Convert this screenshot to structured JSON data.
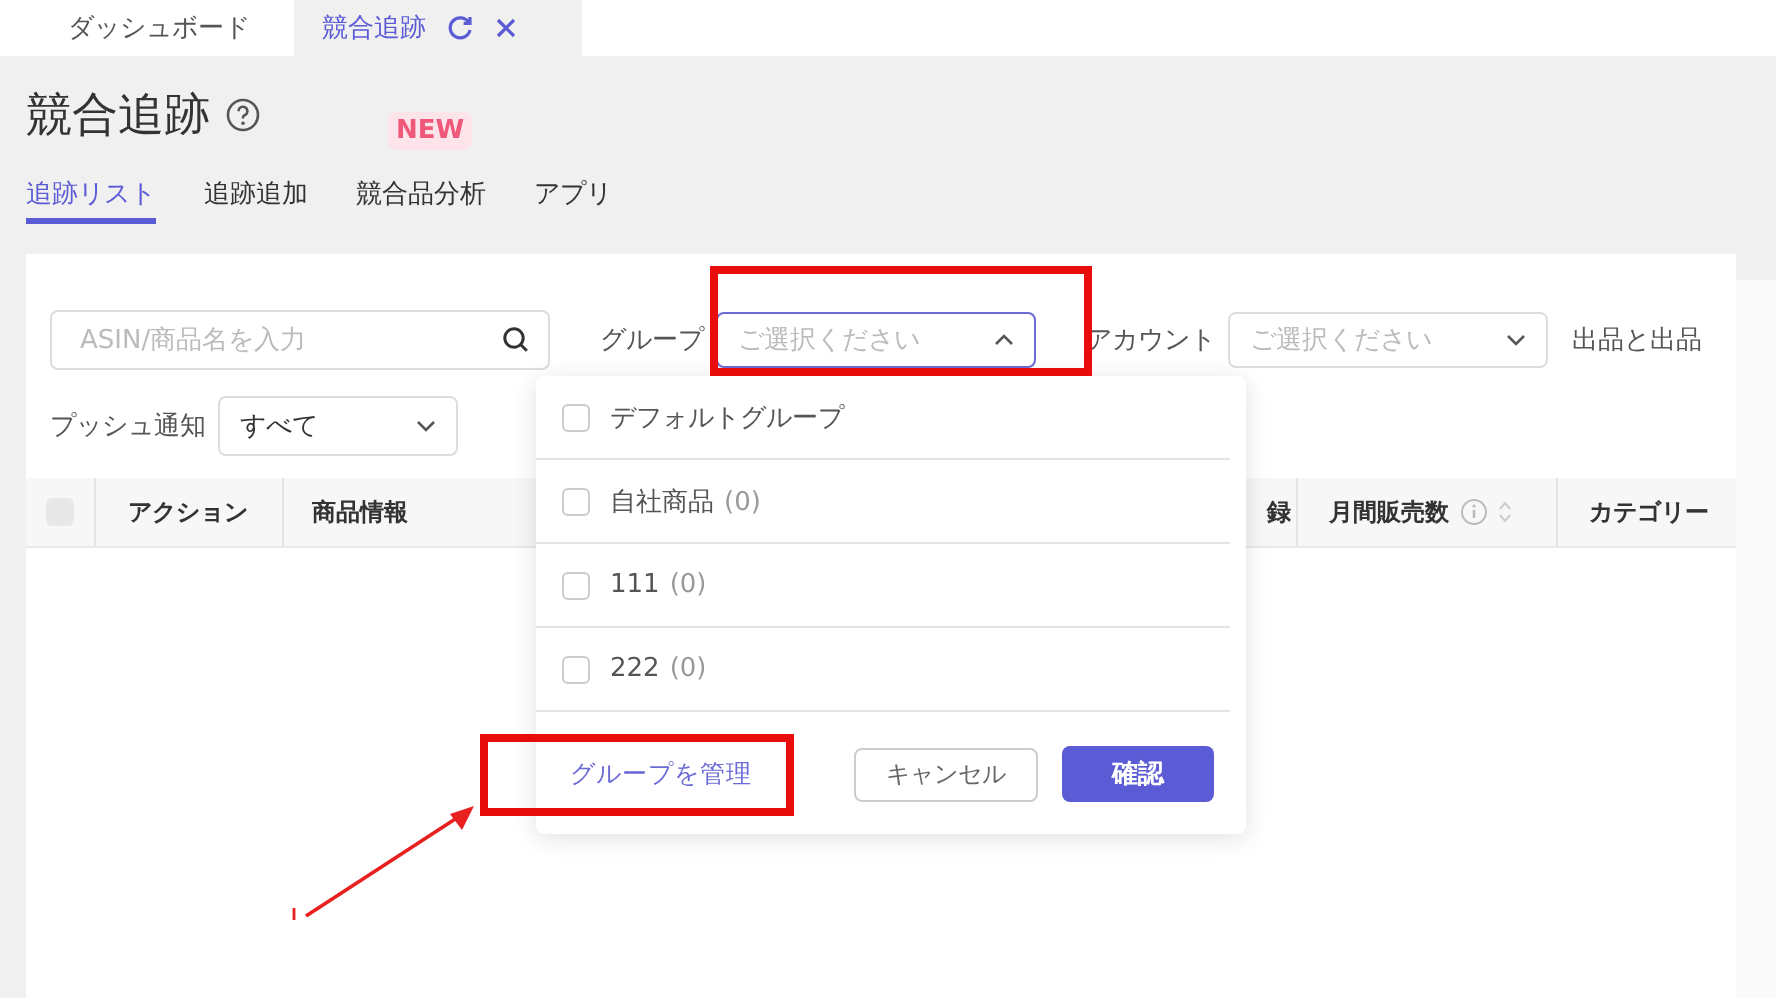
{
  "window_tabs": [
    {
      "label": "ダッシュボード",
      "selected": false
    },
    {
      "label": "競合追跡",
      "selected": true
    }
  ],
  "page": {
    "title": "競合追跡"
  },
  "nav_tabs": [
    {
      "label": "追跡リスト",
      "selected": true
    },
    {
      "label": "追跡追加",
      "selected": false
    },
    {
      "label": "競合品分析",
      "selected": false,
      "badge": "NEW"
    },
    {
      "label": "アプリ",
      "selected": false
    }
  ],
  "filters": {
    "search": {
      "placeholder": "ASIN/商品名を入力"
    },
    "group": {
      "label": "グループ",
      "placeholder": "ご選択ください",
      "open": true
    },
    "account": {
      "label": "アカウント",
      "placeholder": "ご選択ください"
    },
    "listing_label": "出品と出品",
    "push": {
      "label": "プッシュ通知",
      "value": "すべて"
    }
  },
  "table": {
    "select_all_checked": false,
    "columns": [
      {
        "label": "アクション"
      },
      {
        "label": "商品情報"
      },
      {
        "label": "録"
      },
      {
        "label": "月間販売数"
      },
      {
        "label": "カテゴリー"
      }
    ]
  },
  "dropdown": {
    "items": [
      {
        "label": "デフォルトグループ",
        "checked": false
      },
      {
        "label": "自社商品",
        "count": "(0)",
        "checked": false
      },
      {
        "label": "111",
        "count": "(0)",
        "checked": false
      },
      {
        "label": "222",
        "count": "(0)",
        "checked": false
      }
    ],
    "manage_link": "グループを管理",
    "cancel": "キャンセル",
    "confirm": "確認"
  }
}
